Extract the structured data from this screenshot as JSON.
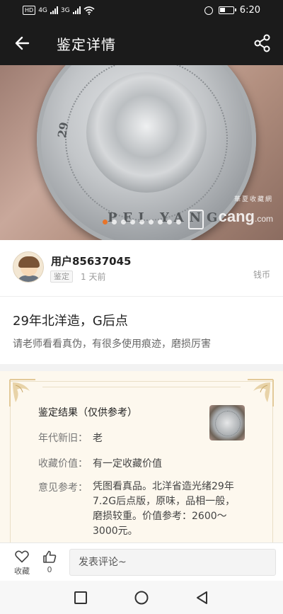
{
  "status_bar": {
    "time": "6:20",
    "network_left": "4G",
    "network_right": "3G",
    "hd": "HD"
  },
  "header": {
    "title": "鉴定详情"
  },
  "hero": {
    "coin_text_bottom": "PEI YANG",
    "coin_text_left": "29",
    "watermark_brand": "cang",
    "watermark_domain": ".com",
    "watermark_cn": "華夏收藏網",
    "slide_count": 9,
    "active_slide": 0
  },
  "user": {
    "name": "用户85637045",
    "tag": "鉴定",
    "time_ago": "1 天前",
    "category": "钱币"
  },
  "post": {
    "title": "29年北洋造，G后点",
    "description": "请老师看看真伪，有很多使用痕迹，磨损厉害"
  },
  "result": {
    "title": "鉴定结果（仅供参考）",
    "age_label": "年代新旧：",
    "age_value": "老",
    "value_label": "收藏价值：",
    "value_value": "有一定收藏价值",
    "opinion_label": "意见参考：",
    "opinion_value": "凭图看真品。北洋省造光绪29年7.2G后点版，原味，品相一般，磨损较重。价值参考：2600～3000元。"
  },
  "bottom": {
    "fav_label": "收藏",
    "like_count": "0",
    "comment_placeholder": "发表评论~"
  },
  "colors": {
    "accent": "#e8742a",
    "header_bg": "#1b1b1b",
    "card_bg": "#fdf8ee"
  }
}
